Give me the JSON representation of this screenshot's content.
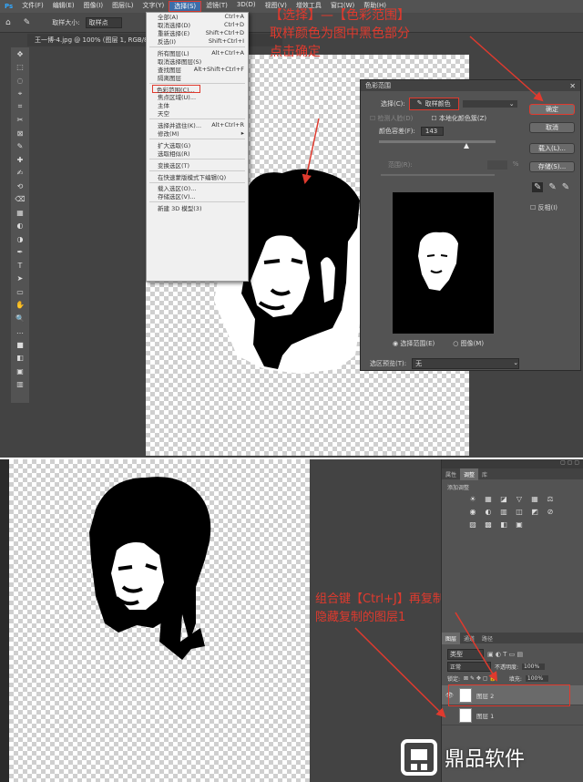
{
  "top": {
    "menubar": [
      "文件(F)",
      "编辑(E)",
      "图像(I)",
      "图层(L)",
      "文字(Y)",
      "选择(S)",
      "滤镜(T)",
      "3D(D)",
      "视图(V)",
      "增效工具",
      "窗口(W)",
      "帮助(H)"
    ],
    "active_menu": "选择(S)",
    "option_bar": {
      "sample_label": "取样大小:",
      "sample_value": "取样点"
    },
    "doc_tab": "王一博-4.jpg @ 100% (图层 1, RGB/8#)",
    "select_menu": [
      {
        "label": "全部(A)",
        "shortcut": "Ctrl+A"
      },
      {
        "label": "取消选择(D)",
        "shortcut": "Ctrl+D"
      },
      {
        "label": "重新选择(E)",
        "shortcut": "Shift+Ctrl+D"
      },
      {
        "label": "反选(I)",
        "shortcut": "Shift+Ctrl+I"
      },
      {
        "sep": true
      },
      {
        "label": "所有图层(L)",
        "shortcut": "Alt+Ctrl+A"
      },
      {
        "label": "取消选择图层(S)",
        "shortcut": ""
      },
      {
        "label": "查找图层",
        "shortcut": "Alt+Shift+Ctrl+F"
      },
      {
        "label": "隔离图层",
        "shortcut": ""
      },
      {
        "sep": true
      },
      {
        "label": "色彩范围(C)...",
        "shortcut": "",
        "highlight": true
      },
      {
        "label": "焦点区域(U)...",
        "shortcut": ""
      },
      {
        "label": "主体",
        "shortcut": ""
      },
      {
        "label": "天空",
        "shortcut": ""
      },
      {
        "sep": true
      },
      {
        "label": "选择并遮住(K)...",
        "shortcut": "Alt+Ctrl+R"
      },
      {
        "label": "修改(M)",
        "shortcut": "▸"
      },
      {
        "sep": true
      },
      {
        "label": "扩大选取(G)",
        "shortcut": ""
      },
      {
        "label": "选取相似(R)",
        "shortcut": ""
      },
      {
        "sep": true
      },
      {
        "label": "变换选区(T)",
        "shortcut": ""
      },
      {
        "sep": true
      },
      {
        "label": "在快速蒙版模式下编辑(Q)",
        "shortcut": ""
      },
      {
        "sep": true
      },
      {
        "label": "载入选区(O)...",
        "shortcut": ""
      },
      {
        "label": "存储选区(V)...",
        "shortcut": ""
      },
      {
        "sep": true
      },
      {
        "label": "新建 3D 模型(3)",
        "shortcut": ""
      }
    ],
    "annotation": {
      "line1": "【选择】—【色彩范围】",
      "line2": "取样颜色为图中黑色部分",
      "line3": "点击确定"
    },
    "dialog": {
      "title": "色彩范围",
      "select_label": "选择(C):",
      "select_value": "取样颜色",
      "detect_faces": "检测人脸(D)",
      "localized": "本地化颜色簇(Z)",
      "fuzziness_label": "颜色容差(F):",
      "fuzziness_value": "143",
      "range_label": "范围(R):",
      "range_unit": "%",
      "radio_selection": "选择范围(E)",
      "radio_image": "图像(M)",
      "preview_label": "选区预览(T):",
      "preview_value": "无",
      "ok": "确定",
      "cancel": "取消",
      "load": "载入(L)...",
      "save": "存储(S)...",
      "invert": "反相(I)"
    }
  },
  "bottom": {
    "annotation": {
      "line1": "组合键【Ctrl+J】再复制一层",
      "line2": "隐藏复制的图层1"
    },
    "panel_tabs": [
      "属性",
      "调整",
      "库"
    ],
    "adjust_label": "添加调整",
    "layers_tabs": [
      "图层",
      "通道",
      "路径"
    ],
    "kind_label": "类型",
    "blend_mode": "正常",
    "opacity_label": "不透明度:",
    "opacity_value": "100%",
    "lock_label": "锁定:",
    "fill_label": "填充:",
    "fill_value": "100%",
    "layers": [
      {
        "name": "图层 2",
        "visible": true
      },
      {
        "name": "图层 1",
        "visible": false
      }
    ]
  },
  "watermark": "鼎品软件",
  "colors": {
    "annotation": "#e03a2e",
    "ps_dark": "#434343",
    "ps_panel": "#535353",
    "highlight": "#3d6da8"
  }
}
